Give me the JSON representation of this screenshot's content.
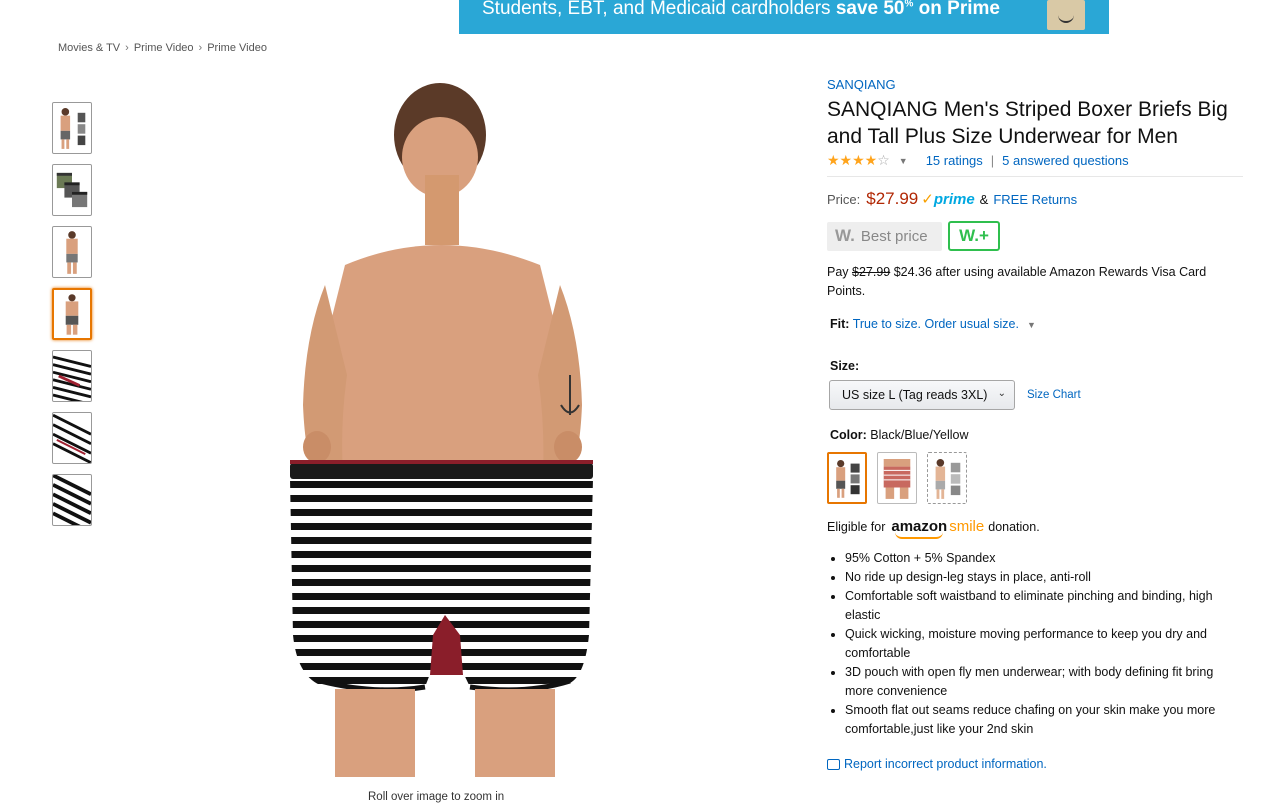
{
  "banner": {
    "text_normal": "Students, EBT, and Medicaid cardholders ",
    "text_bold": "save 50",
    "text_sup": "%",
    "text_bold2": " on Prime"
  },
  "breadcrumb": [
    "Movies & TV",
    "Prime Video",
    "Prime Video"
  ],
  "gallery": {
    "zoom_hint": "Roll over image to zoom in",
    "selected_index": 3
  },
  "product": {
    "brand": "SANQIANG",
    "title": "SANQIANG Men's Striped Boxer Briefs Big and Tall Plus Size Underwear for Men",
    "stars": "★★★★",
    "star_empty": "☆",
    "rating_value": 4,
    "ratings_text": "15 ratings",
    "answered_text": "5 answered questions",
    "price_label": "Price:",
    "price": "$27.99",
    "prime_check": "✓",
    "prime": "prime",
    "amp": "&",
    "free_returns": "FREE Returns",
    "wbest_w": "W.",
    "wbest_text": "Best price",
    "wplus": "W.+",
    "pay_prefix": "Pay ",
    "pay_old": "$27.99",
    "pay_rest": " $24.36 after using available Amazon Rewards Visa Card Points.",
    "fit_label": "Fit:",
    "fit_value": "True to size. Order usual size.",
    "size_label": "Size:",
    "size_selected": "US size L (Tag reads 3XL)",
    "size_chart": "Size Chart",
    "color_label": "Color:",
    "color_value": "Black/Blue/Yellow",
    "smile_prefix": "Eligible for",
    "smile_amazon": "amazon",
    "smile_word": "smile",
    "smile_suffix": "donation.",
    "bullets": [
      "95% Cotton + 5% Spandex",
      "No ride up design-leg stays in place, anti-roll",
      "Comfortable soft waistband to eliminate pinching and binding, high elastic",
      "Quick wicking, moisture moving performance to keep you dry and comfortable",
      "3D pouch with open fly men underwear; with body defining fit bring more convenience",
      "Smooth flat out seams reduce chafing on your skin make you more comfortable,just like your 2nd skin"
    ],
    "report": "Report incorrect product information."
  },
  "colors": {
    "price": "#b12704",
    "link": "#0066c0",
    "prime": "#00a8e1",
    "selected_border": "#e77600",
    "banner_bg": "#2aa7d6"
  }
}
